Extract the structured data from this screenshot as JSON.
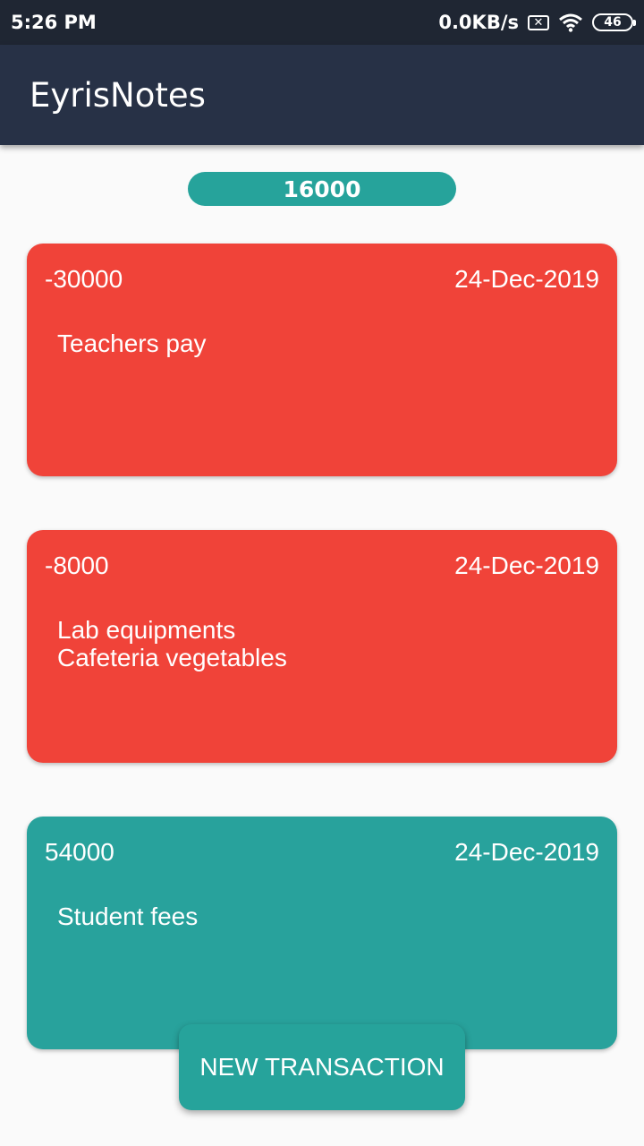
{
  "status_bar": {
    "time": "5:26 PM",
    "network_speed": "0.0KB/s",
    "sim_icon": "sim-x-icon",
    "wifi_icon": "wifi-icon",
    "battery": "46"
  },
  "app_bar": {
    "title": "EyrisNotes"
  },
  "balance": "16000",
  "colors": {
    "app_bar": "#273146",
    "expense": "#f04339",
    "income": "#28a29c",
    "accent": "#26a39b"
  },
  "transactions": [
    {
      "amount": "-30000",
      "date": "24-Dec-2019",
      "lines": [
        "Teachers pay"
      ]
    },
    {
      "amount": "-8000",
      "date": "24-Dec-2019",
      "lines": [
        "Lab equipments",
        "Cafeteria vegetables"
      ]
    },
    {
      "amount": "54000",
      "date": "24-Dec-2019",
      "lines": [
        "Student fees"
      ]
    }
  ],
  "actions": {
    "new_transaction": "NEW TRANSACTION"
  }
}
